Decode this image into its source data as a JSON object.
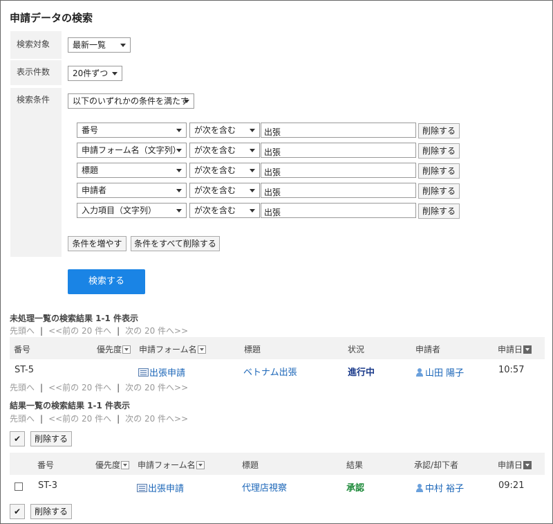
{
  "page": {
    "title": "申請データの検索"
  },
  "search": {
    "target_label": "検索対象",
    "target_value": "最新一覧",
    "count_label": "表示件数",
    "count_value": "20件ずつ",
    "cond_label": "検索条件",
    "cond_mode": "以下のいずれかの条件を満たす",
    "conditions": [
      {
        "field": "番号",
        "op": "が次を含む",
        "value": "出張",
        "delete": "削除する"
      },
      {
        "field": "申請フォーム名（文字列）",
        "op": "が次を含む",
        "value": "出張",
        "delete": "削除する"
      },
      {
        "field": "標題",
        "op": "が次を含む",
        "value": "出張",
        "delete": "削除する"
      },
      {
        "field": "申請者",
        "op": "が次を含む",
        "value": "出張",
        "delete": "削除する"
      },
      {
        "field": "入力項目（文字列）",
        "op": "が次を含む",
        "value": "出張",
        "delete": "削除する"
      }
    ],
    "add_condition": "条件を増やす",
    "delete_all": "条件をすべて削除する",
    "submit": "検索する"
  },
  "pending": {
    "title": "未処理一覧の検索結果 1-1 件表示",
    "pager": {
      "first": "先頭へ",
      "prev": "<<前の 20 件へ",
      "next": "次の 20 件へ>>"
    },
    "columns": {
      "no": "番号",
      "priority": "優先度",
      "form": "申請フォーム名",
      "subject": "標題",
      "status": "状況",
      "applicant": "申請者",
      "date": "申請日"
    },
    "rows": [
      {
        "no": "ST-5",
        "form": "出張申請",
        "subject": "ベトナム出張",
        "status": "進行中",
        "applicant": "山田 陽子",
        "date": "10:57"
      }
    ]
  },
  "results": {
    "title": "結果一覧の検索結果 1-1 件表示",
    "pager": {
      "first": "先頭へ",
      "prev": "<<前の 20 件へ",
      "next": "次の 20 件へ>>"
    },
    "check_glyph": "✔",
    "delete": "削除する",
    "columns": {
      "no": "番号",
      "priority": "優先度",
      "form": "申請フォーム名",
      "subject": "標題",
      "result": "結果",
      "approver": "承認/却下者",
      "date": "申請日"
    },
    "rows": [
      {
        "no": "ST-3",
        "form": "出張申請",
        "subject": "代理店視察",
        "result": "承認",
        "approver": "中村 裕子",
        "date": "09:21"
      }
    ]
  },
  "colors": {
    "primary": "#1a84e5",
    "link": "#1b66b8",
    "in_progress": "#1a3a8a",
    "approved": "#1e8a3a"
  }
}
